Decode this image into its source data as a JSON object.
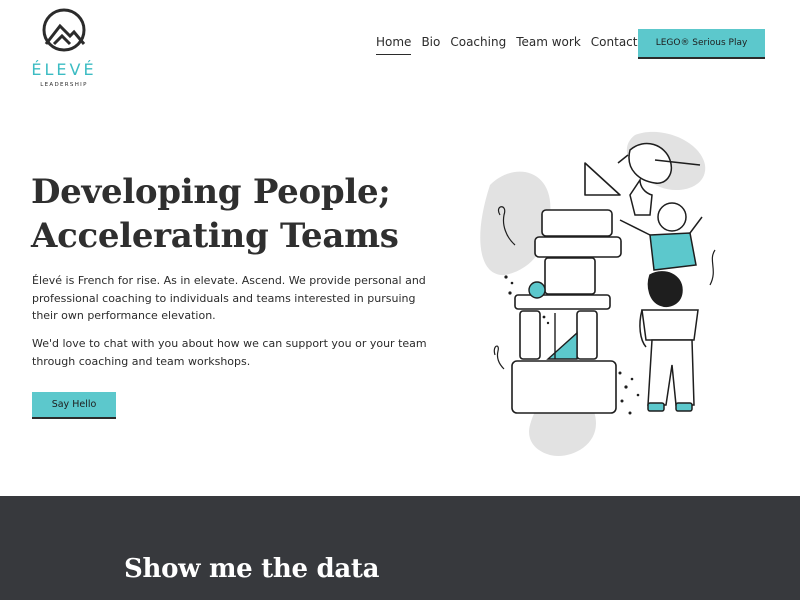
{
  "brand": {
    "name": "ÉLEVÉ",
    "tagline": "LEADERSHIP",
    "accent_color": "#5cc8cc",
    "dark_color": "#37393d"
  },
  "nav": {
    "items": [
      {
        "label": "Home",
        "active": true
      },
      {
        "label": "Bio",
        "active": false
      },
      {
        "label": "Coaching",
        "active": false
      },
      {
        "label": "Team work",
        "active": false
      },
      {
        "label": "Contact",
        "active": false
      }
    ],
    "cta_label": "LEGO® Serious Play"
  },
  "hero": {
    "title_line1": "Developing People;",
    "title_line2": "Accelerating Teams",
    "paragraph1": "Élevé is French for rise. As in elevate. Ascend. We provide personal and professional coaching to individuals and teams interested in pursuing their own performance elevation.",
    "paragraph2": "We'd love to chat with you about how we can support you or your team through coaching and team workshops.",
    "button_label": "Say Hello",
    "illustration_icon": "people-stacking-blocks-illustration"
  },
  "section": {
    "title": "Show me the data"
  }
}
